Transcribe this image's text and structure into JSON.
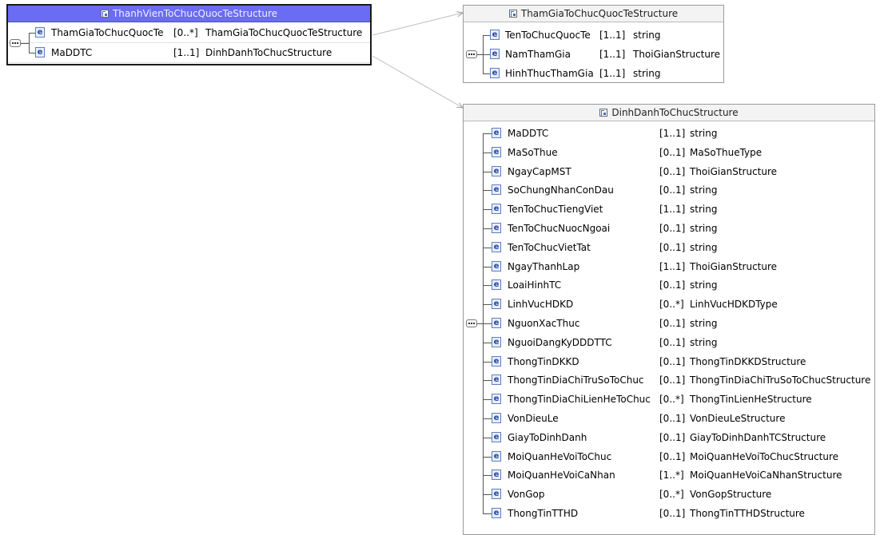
{
  "diagram": {
    "box1": {
      "title": "ThanhVienToChucQuocTeStructure",
      "rows": [
        {
          "name": "ThamGiaToChucQuocTe",
          "card": "[0..*]",
          "type": "ThamGiaToChucQuocTeStructure"
        },
        {
          "name": "MaDDTC",
          "card": "[1..1]",
          "type": "DinhDanhToChucStructure"
        }
      ]
    },
    "box2": {
      "title": "ThamGiaToChucQuocTeStructure",
      "rows": [
        {
          "name": "TenToChucQuocTe",
          "card": "[1..1]",
          "type": "string"
        },
        {
          "name": "NamThamGia",
          "card": "[1..1]",
          "type": "ThoiGianStructure"
        },
        {
          "name": "HinhThucThamGia",
          "card": "[1..1]",
          "type": "string"
        }
      ]
    },
    "box3": {
      "title": "DinhDanhToChucStructure",
      "rows": [
        {
          "name": "MaDDTC",
          "card": "[1..1]",
          "type": "string"
        },
        {
          "name": "MaSoThue",
          "card": "[0..1]",
          "type": "MaSoThueType"
        },
        {
          "name": "NgayCapMST",
          "card": "[0..1]",
          "type": "ThoiGianStructure"
        },
        {
          "name": "SoChungNhanConDau",
          "card": "[0..1]",
          "type": "string"
        },
        {
          "name": "TenToChucTiengViet",
          "card": "[1..1]",
          "type": "string"
        },
        {
          "name": "TenToChucNuocNgoai",
          "card": "[0..1]",
          "type": "string"
        },
        {
          "name": "TenToChucVietTat",
          "card": "[0..1]",
          "type": "string"
        },
        {
          "name": "NgayThanhLap",
          "card": "[1..1]",
          "type": "ThoiGianStructure"
        },
        {
          "name": "LoaiHinhTC",
          "card": "[0..1]",
          "type": "string"
        },
        {
          "name": "LinhVucHDKD",
          "card": "[0..*]",
          "type": "LinhVucHDKDType"
        },
        {
          "name": "NguonXacThuc",
          "card": "[0..1]",
          "type": "string"
        },
        {
          "name": "NguoiDangKyDDDTTC",
          "card": "[0..1]",
          "type": "string"
        },
        {
          "name": "ThongTinDKKD",
          "card": "[0..1]",
          "type": "ThongTinDKKDStructure"
        },
        {
          "name": "ThongTinDiaChiTruSoToChuc",
          "card": "[0..1]",
          "type": "ThongTinDiaChiTruSoToChucStructure"
        },
        {
          "name": "ThongTinDiaChiLienHeToChuc",
          "card": "[0..*]",
          "type": "ThongTinLienHeStructure"
        },
        {
          "name": "VonDieuLe",
          "card": "[0..1]",
          "type": "VonDieuLeStructure"
        },
        {
          "name": "GiayToDinhDanh",
          "card": "[0..1]",
          "type": "GiayToDinhDanhTCStructure"
        },
        {
          "name": "MoiQuanHeVoiToChuc",
          "card": "[0..1]",
          "type": "MoiQuanHeVoiToChucStructure"
        },
        {
          "name": "MoiQuanHeVoiCaNhan",
          "card": "[1..*]",
          "type": "MoiQuanHeVoiCaNhanStructure"
        },
        {
          "name": "VonGop",
          "card": "[0..*]",
          "type": "VonGopStructure"
        },
        {
          "name": "ThongTinTTHD",
          "card": "[0..1]",
          "type": "ThongTinTTHDStructure"
        }
      ]
    },
    "element_icon_text": "e",
    "colors": {
      "box1_header": "#6a6cf4",
      "box1_border": "#1a1a1a",
      "box_border": "#9a9a9a",
      "link_line": "#b8b8b8"
    }
  }
}
